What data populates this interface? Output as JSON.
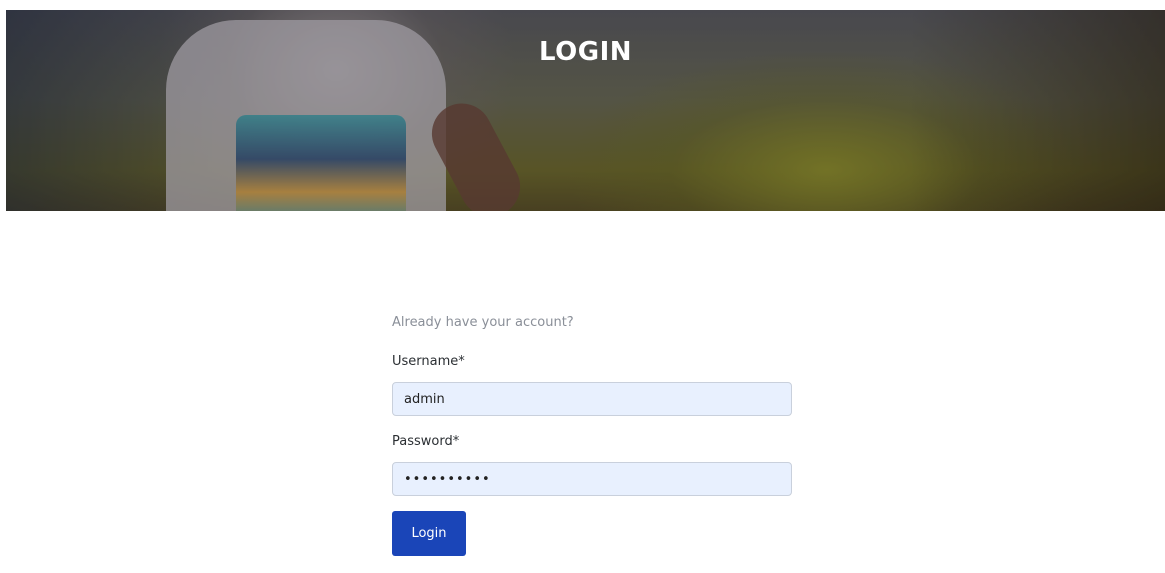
{
  "banner": {
    "title": "LOGIN"
  },
  "login_form": {
    "subtitle": "Already have your account?",
    "username_label": "Username*",
    "username_value": "admin",
    "password_label": "Password*",
    "password_value": "••••••••••",
    "submit_label": "Login"
  },
  "colors": {
    "button_bg": "#1a45b8",
    "input_bg": "#e8f0fe",
    "label_text": "#2b2f33",
    "muted_text": "#8a8f98"
  }
}
